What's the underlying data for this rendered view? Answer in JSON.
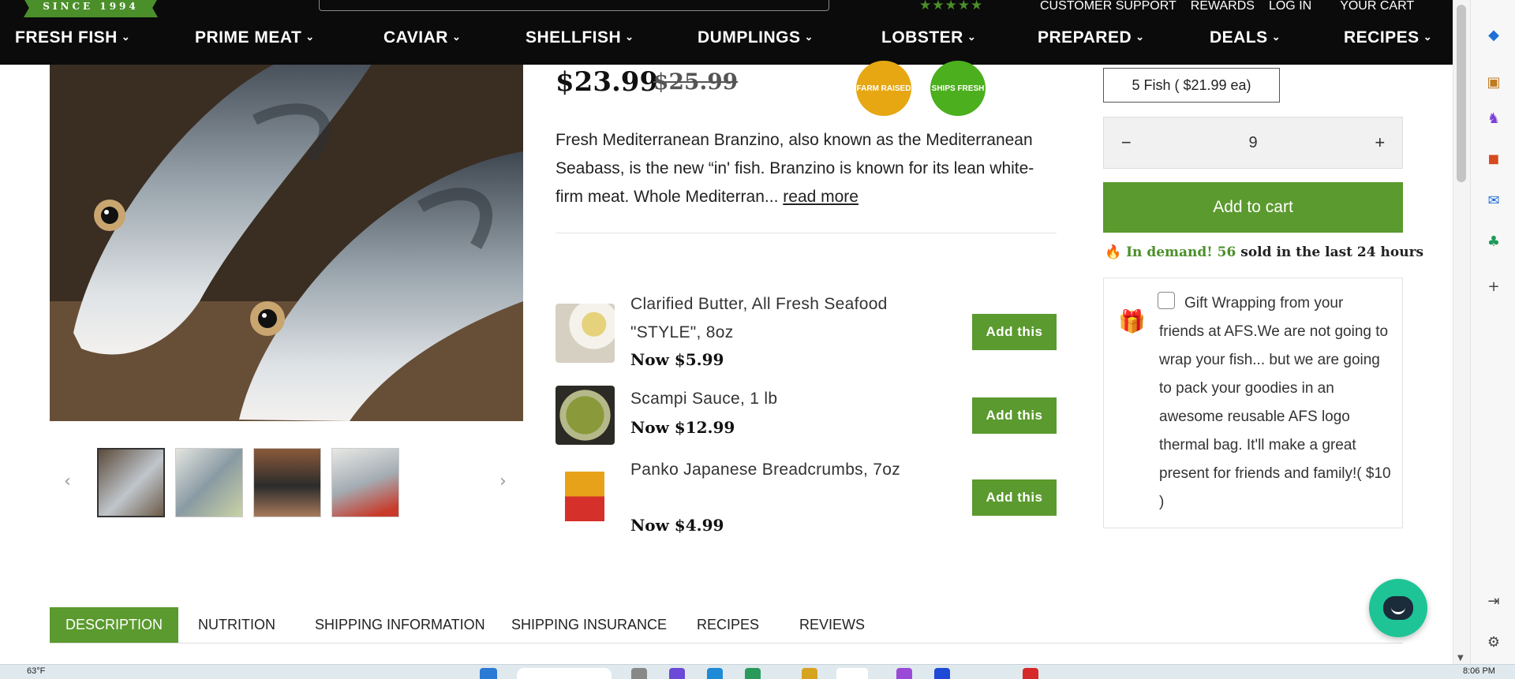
{
  "header": {
    "logo_tagline": "SINCE 1994",
    "rating_stars": "★★★★★",
    "util_links": [
      "CUSTOMER SUPPORT",
      "REWARDS",
      "LOG IN",
      "YOUR CART"
    ],
    "nav": [
      "FRESH FISH",
      "PRIME MEAT",
      "CAVIAR",
      "SHELLFISH",
      "DUMPLINGS",
      "LOBSTER",
      "PREPARED",
      "DEALS",
      "RECIPES"
    ],
    "chevron": "⌄"
  },
  "product": {
    "price_now": "$23.99",
    "price_was": "$25.99",
    "badge_farm": "FARM RAISED",
    "badge_fresh": "SHIPS FRESH",
    "description": "Fresh Mediterranean Branzino, also known as the Mediterranean Seabass, is the new “in' fish. Branzino is known for its lean white-firm meat. Whole Mediterran...",
    "read_more": "read more"
  },
  "addons": [
    {
      "name": "Clarified Butter, All Fresh Seafood \"STYLE\", 8oz",
      "price": "Now $5.99",
      "button": "Add this"
    },
    {
      "name": "Scampi Sauce, 1 lb",
      "price": "Now $12.99",
      "button": "Add this"
    },
    {
      "name": "Panko Japanese Breadcrumbs, 7oz",
      "price": "Now $4.99",
      "button": "Add this"
    }
  ],
  "purchase": {
    "variant": "5 Fish ( $21.99 ea)",
    "qty_minus": "−",
    "qty_value": "9",
    "qty_plus": "+",
    "add_to_cart": "Add to cart",
    "demand_label": "In demand!",
    "demand_count": "56",
    "demand_suffix": "sold in the last 24 hours",
    "gift_text": "Gift Wrapping from your friends at AFS.We are not going to wrap your fish... but we are going to pack your goodies in an awesome reusable AFS logo thermal bag. It'll make a great present for friends and family!( $10 )"
  },
  "tabs": [
    "DESCRIPTION",
    "NUTRITION",
    "SHIPPING INFORMATION",
    "SHIPPING INSURANCE",
    "RECIPES",
    "REVIEWS"
  ],
  "gallery": {
    "prev": "‹",
    "next": "›"
  },
  "taskbar": {
    "temp": "63°F",
    "time": "8:06 PM"
  },
  "colors": {
    "brand_green": "#5b9a2e",
    "header_bg": "#0b0b0b",
    "chat": "#1ec496",
    "badge_farm": "#e6a713",
    "badge_fresh": "#4caf1e"
  }
}
